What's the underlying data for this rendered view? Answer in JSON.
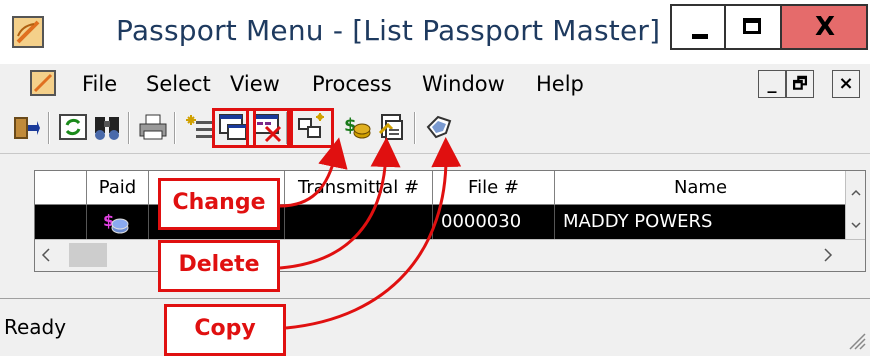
{
  "window": {
    "title": "Passport Menu - [List Passport Master]",
    "controls": {
      "minimize": "_",
      "maximize": "□",
      "close": "X"
    }
  },
  "menubar": {
    "items": [
      "File",
      "Select",
      "View",
      "Process",
      "Window",
      "Help"
    ],
    "mdi_controls": [
      "_",
      "🗗",
      "×"
    ]
  },
  "toolbar": {
    "buttons": [
      "exit-icon",
      "refresh-icon",
      "find-icon",
      "print-icon",
      "add-icon",
      "change-icon",
      "delete-icon",
      "copy-icon",
      "payment-icon",
      "report-icon",
      "tag-icon"
    ],
    "highlighted": [
      "change-icon",
      "delete-icon",
      "copy-icon"
    ]
  },
  "grid": {
    "columns": [
      "",
      "Paid",
      "",
      "Transmittal #",
      "File #",
      "Name"
    ],
    "rows": [
      {
        "selector": "",
        "paid_icon": "money-icon",
        "col3": "",
        "transmittal": "",
        "file": "0000030",
        "name": "MADDY POWERS"
      }
    ]
  },
  "status": {
    "text": "Ready"
  },
  "callouts": {
    "change": "Change",
    "delete": "Delete",
    "copy": "Copy"
  },
  "colors": {
    "accent": "#e01010",
    "close_button": "#e56b6b",
    "selected_row": "#000000"
  }
}
